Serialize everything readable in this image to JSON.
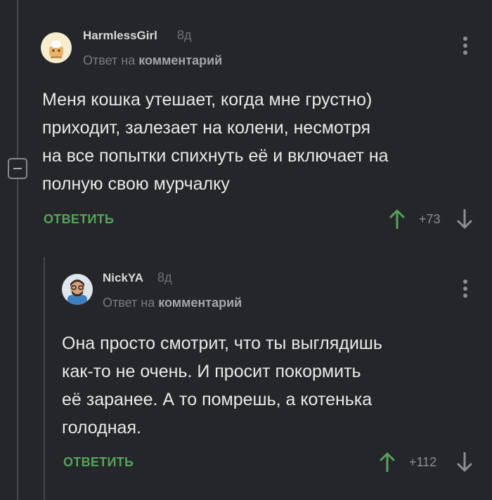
{
  "comments": [
    {
      "username": "HarmlessGirl",
      "time": "8д",
      "reply_prefix": "Ответ на ",
      "reply_link": "комментарий",
      "text_lines": [
        "Меня кошка утешает, когда мне грустно)",
        "приходит, залезает на колени, несмотря",
        "на все попытки спихнуть её и включает на",
        "полную свою мурчалку"
      ],
      "reply_label": "ОТВЕТИТЬ",
      "score": "+73"
    },
    {
      "username": "NickYA",
      "time": "8д",
      "reply_prefix": "Ответ на ",
      "reply_link": "комментарий",
      "text_lines": [
        "Она просто смотрит, что ты выглядишь",
        "как-то не очень. И просит покормить",
        "её заранее. А то помрешь, а котенька",
        "голодная."
      ],
      "reply_label": "ОТВЕТИТЬ",
      "score": "+112"
    }
  ],
  "colors": {
    "background": "#24262a",
    "text": "#e8e9ea",
    "accent_green": "#57a35c",
    "muted": "#8b8e94"
  },
  "icons": [
    "minus-icon",
    "kebab-menu-icon",
    "upvote-arrow-icon",
    "downvote-arrow-icon"
  ]
}
